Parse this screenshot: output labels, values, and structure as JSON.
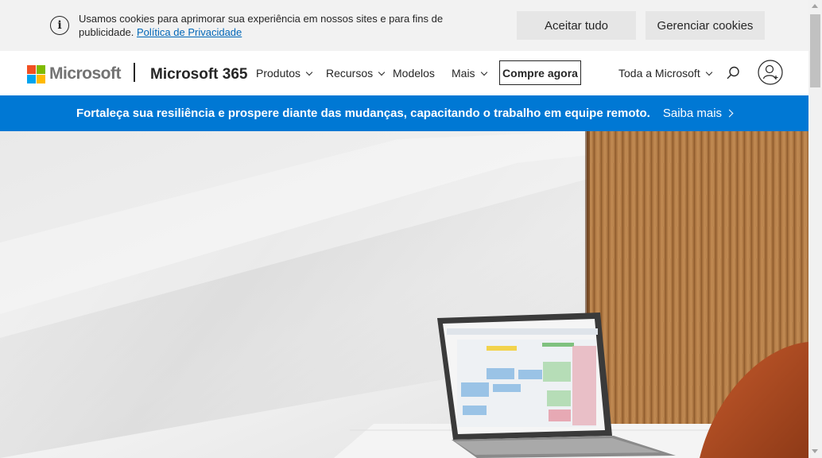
{
  "cookie_banner": {
    "message": "Usamos cookies para aprimorar sua experiência em nossos sites e para fins de publicidade.",
    "privacy_link": "Política de Privacidade",
    "accept_label": "Aceitar tudo",
    "manage_label": "Gerenciar cookies"
  },
  "header": {
    "brand": "Microsoft",
    "product": "Microsoft 365",
    "nav": {
      "products": "Produtos",
      "resources": "Recursos",
      "templates": "Modelos",
      "more": "Mais"
    },
    "buy_label": "Compre agora",
    "all_microsoft": "Toda a Microsoft"
  },
  "promo": {
    "text": "Fortaleça sua resiliência e prospere diante das mudanças, capacitando o trabalho em equipe remoto.",
    "link": "Saiba mais"
  },
  "colors": {
    "accent": "#0078d4",
    "link": "#0067b8",
    "logo_red": "#f25022",
    "logo_green": "#7fba00",
    "logo_blue": "#00a4ef",
    "logo_yellow": "#ffb900"
  }
}
